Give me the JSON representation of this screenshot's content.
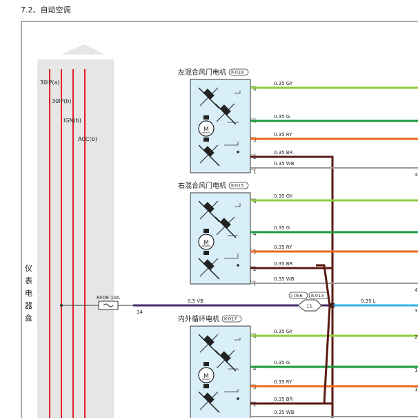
{
  "page": {
    "heading": "7.2、自动空调"
  },
  "rails": {
    "box_label": [
      "仪",
      "表",
      "电",
      "器",
      "盒"
    ],
    "r1": "30IP(a)",
    "r2": "30IP(b)",
    "r3": "IGN(b)",
    "r4": "ACC(b)"
  },
  "fuse": {
    "label": "RF09 10A",
    "out_pin": "34"
  },
  "motors": [
    {
      "title": "左混合风门电机",
      "code": "K-018",
      "pins": [
        "6",
        "4",
        "3",
        "2",
        "1"
      ],
      "wires": [
        "0.35 GY",
        "0.35 G",
        "0.35 RY",
        "0.35 BR",
        "0.35 WB"
      ],
      "right_pins": [
        "4"
      ]
    },
    {
      "title": "右混合风门电机",
      "code": "K-015",
      "pins": [
        "6",
        "4",
        "3",
        "2",
        "1"
      ],
      "wires": [
        "0.35 GY",
        "0.35 G",
        "0.35 RY",
        "0.35 BR",
        "0.35 WB"
      ],
      "right_pins": [
        "4",
        "3"
      ]
    },
    {
      "title": "内外循环电机",
      "code": "K-017",
      "pins": [
        "6",
        "4",
        "3",
        "2"
      ],
      "wires": [
        "0.35 GY",
        "0.35 G",
        "0.35 RY",
        "0.35 BR",
        "0.35 WB"
      ],
      "right_pins": [
        "2",
        "1",
        "1"
      ]
    }
  ],
  "power_line": {
    "wire": "0.5 VB",
    "conn1": "I-056",
    "conn2": "K-013",
    "splice": "11",
    "out_wire": "0.35 L"
  },
  "motor_symbol": "M",
  "colors": {
    "GY": "#8ccf3c",
    "G": "#1a9a3a",
    "RY": "#ee6a1a",
    "BR": "#5a1a12",
    "WB": "#9a9a9a",
    "VB": "#4b2a6e",
    "L": "#2fb3e6",
    "rail": "#e32028",
    "module_fill": "#d8eef8",
    "module_stroke": "#333333"
  }
}
